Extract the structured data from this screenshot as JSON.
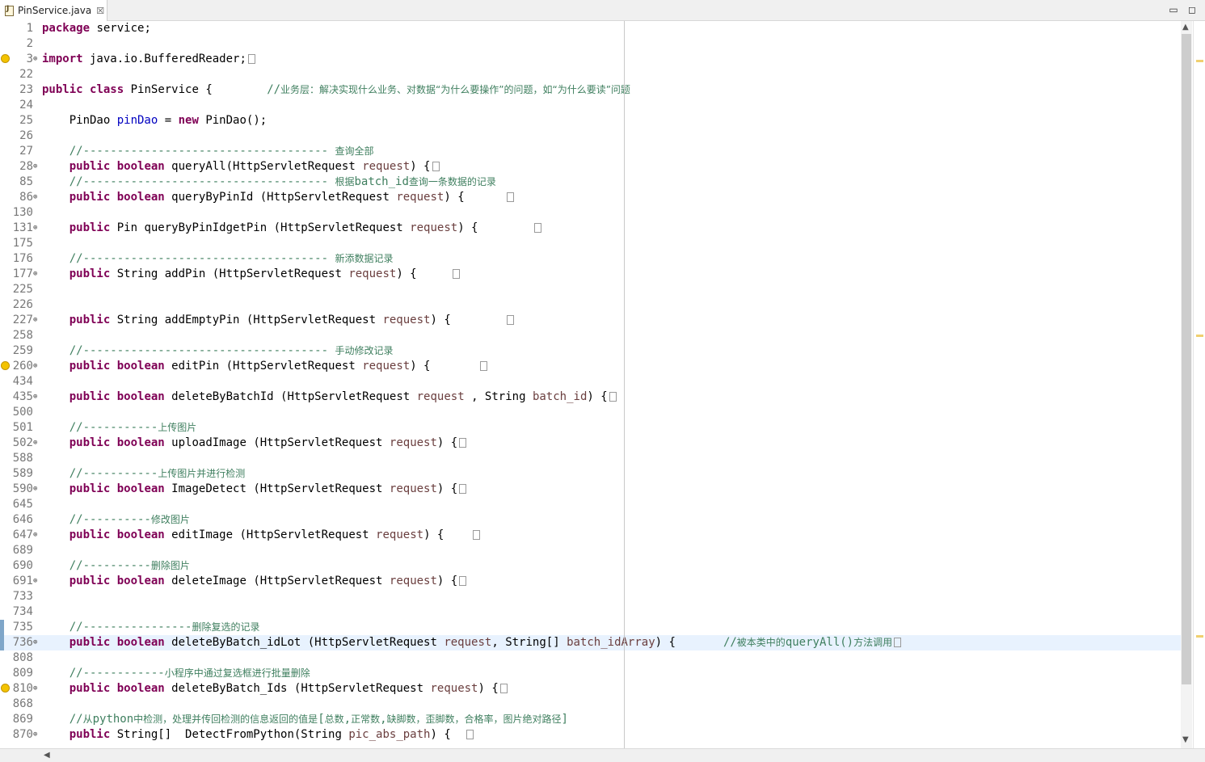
{
  "tab": {
    "title": "PinService.java",
    "close": "☒"
  },
  "window": {
    "minimize": "▭",
    "maximize": "◻"
  },
  "lines": [
    {
      "n": "1",
      "parts": [
        [
          "kw",
          "package"
        ],
        [
          "t",
          " service;"
        ]
      ]
    },
    {
      "n": "2",
      "parts": []
    },
    {
      "n": "3",
      "fold": true,
      "warn": true,
      "parts": [
        [
          "kw",
          "import"
        ],
        [
          "t",
          " java.io.BufferedReader;"
        ],
        [
          "box",
          ""
        ]
      ]
    },
    {
      "n": "22",
      "parts": []
    },
    {
      "n": "23",
      "parts": [
        [
          "kw",
          "public"
        ],
        [
          "t",
          " "
        ],
        [
          "kw",
          "class"
        ],
        [
          "t",
          " PinService {        "
        ],
        [
          "cmt",
          "//"
        ],
        [
          "cmtcn",
          "业务层：解决实现什么业务、对数据“为什么要操作”的问题，如“为什么要读”问题"
        ]
      ]
    },
    {
      "n": "24",
      "parts": []
    },
    {
      "n": "25",
      "parts": [
        [
          "t",
          "    PinDao "
        ],
        [
          "fld",
          "pinDao"
        ],
        [
          "t",
          " = "
        ],
        [
          "kw",
          "new"
        ],
        [
          "t",
          " PinDao();"
        ]
      ]
    },
    {
      "n": "26",
      "parts": []
    },
    {
      "n": "27",
      "parts": [
        [
          "t",
          "    "
        ],
        [
          "cmt",
          "//------------------------------------ "
        ],
        [
          "cmtcn",
          "查询全部"
        ]
      ]
    },
    {
      "n": "28",
      "fold": true,
      "parts": [
        [
          "t",
          "    "
        ],
        [
          "kw",
          "public"
        ],
        [
          "t",
          " "
        ],
        [
          "kw",
          "boolean"
        ],
        [
          "t",
          " queryAll(HttpServletRequest "
        ],
        [
          "prm",
          "request"
        ],
        [
          "t",
          ") {"
        ],
        [
          "box",
          ""
        ]
      ]
    },
    {
      "n": "85",
      "parts": [
        [
          "t",
          "    "
        ],
        [
          "cmt",
          "//------------------------------------ "
        ],
        [
          "cmtcn",
          "根据"
        ],
        [
          "cmt",
          "batch_id"
        ],
        [
          "cmtcn",
          "查询一条数据的记录"
        ]
      ]
    },
    {
      "n": "86",
      "fold": true,
      "parts": [
        [
          "t",
          "    "
        ],
        [
          "kw",
          "public"
        ],
        [
          "t",
          " "
        ],
        [
          "kw",
          "boolean"
        ],
        [
          "t",
          " queryByPinId (HttpServletRequest "
        ],
        [
          "prm",
          "request"
        ],
        [
          "t",
          ") {      "
        ],
        [
          "box",
          ""
        ]
      ]
    },
    {
      "n": "130",
      "parts": []
    },
    {
      "n": "131",
      "fold": true,
      "parts": [
        [
          "t",
          "    "
        ],
        [
          "kw",
          "public"
        ],
        [
          "t",
          " Pin queryByPinIdgetPin (HttpServletRequest "
        ],
        [
          "prm",
          "request"
        ],
        [
          "t",
          ") {        "
        ],
        [
          "box",
          ""
        ]
      ]
    },
    {
      "n": "175",
      "parts": []
    },
    {
      "n": "176",
      "parts": [
        [
          "t",
          "    "
        ],
        [
          "cmt",
          "//------------------------------------ "
        ],
        [
          "cmtcn",
          "新添数据记录"
        ]
      ]
    },
    {
      "n": "177",
      "fold": true,
      "parts": [
        [
          "t",
          "    "
        ],
        [
          "kw",
          "public"
        ],
        [
          "t",
          " String addPin (HttpServletRequest "
        ],
        [
          "prm",
          "request"
        ],
        [
          "t",
          ") {     "
        ],
        [
          "box",
          ""
        ]
      ]
    },
    {
      "n": "225",
      "parts": []
    },
    {
      "n": "226",
      "parts": []
    },
    {
      "n": "227",
      "fold": true,
      "parts": [
        [
          "t",
          "    "
        ],
        [
          "kw",
          "public"
        ],
        [
          "t",
          " String addEmptyPin (HttpServletRequest "
        ],
        [
          "prm",
          "request"
        ],
        [
          "t",
          ") {        "
        ],
        [
          "box",
          ""
        ]
      ]
    },
    {
      "n": "258",
      "parts": []
    },
    {
      "n": "259",
      "parts": [
        [
          "t",
          "    "
        ],
        [
          "cmt",
          "//------------------------------------ "
        ],
        [
          "cmtcn",
          "手动修改记录"
        ]
      ]
    },
    {
      "n": "260",
      "fold": true,
      "warn": true,
      "parts": [
        [
          "t",
          "    "
        ],
        [
          "kw",
          "public"
        ],
        [
          "t",
          " "
        ],
        [
          "kw",
          "boolean"
        ],
        [
          "t",
          " editPin (HttpServletRequest "
        ],
        [
          "prm",
          "request"
        ],
        [
          "t",
          ") {       "
        ],
        [
          "box",
          ""
        ]
      ]
    },
    {
      "n": "434",
      "parts": []
    },
    {
      "n": "435",
      "fold": true,
      "parts": [
        [
          "t",
          "    "
        ],
        [
          "kw",
          "public"
        ],
        [
          "t",
          " "
        ],
        [
          "kw",
          "boolean"
        ],
        [
          "t",
          " deleteByBatchId (HttpServletRequest "
        ],
        [
          "prm",
          "request"
        ],
        [
          "t",
          " , String "
        ],
        [
          "prm",
          "batch_id"
        ],
        [
          "t",
          ") {"
        ],
        [
          "box",
          ""
        ]
      ]
    },
    {
      "n": "500",
      "parts": []
    },
    {
      "n": "501",
      "parts": [
        [
          "t",
          "    "
        ],
        [
          "cmt",
          "//-----------"
        ],
        [
          "cmtcn",
          "上传图片"
        ]
      ]
    },
    {
      "n": "502",
      "fold": true,
      "parts": [
        [
          "t",
          "    "
        ],
        [
          "kw",
          "public"
        ],
        [
          "t",
          " "
        ],
        [
          "kw",
          "boolean"
        ],
        [
          "t",
          " uploadImage (HttpServletRequest "
        ],
        [
          "prm",
          "request"
        ],
        [
          "t",
          ") {"
        ],
        [
          "box",
          ""
        ]
      ]
    },
    {
      "n": "588",
      "parts": []
    },
    {
      "n": "589",
      "parts": [
        [
          "t",
          "    "
        ],
        [
          "cmt",
          "//-----------"
        ],
        [
          "cmtcn",
          "上传图片并进行检测"
        ]
      ]
    },
    {
      "n": "590",
      "fold": true,
      "parts": [
        [
          "t",
          "    "
        ],
        [
          "kw",
          "public"
        ],
        [
          "t",
          " "
        ],
        [
          "kw",
          "boolean"
        ],
        [
          "t",
          " ImageDetect (HttpServletRequest "
        ],
        [
          "prm",
          "request"
        ],
        [
          "t",
          ") {"
        ],
        [
          "box",
          ""
        ]
      ]
    },
    {
      "n": "645",
      "parts": []
    },
    {
      "n": "646",
      "parts": [
        [
          "t",
          "    "
        ],
        [
          "cmt",
          "//----------"
        ],
        [
          "cmtcn",
          "修改图片"
        ]
      ]
    },
    {
      "n": "647",
      "fold": true,
      "parts": [
        [
          "t",
          "    "
        ],
        [
          "kw",
          "public"
        ],
        [
          "t",
          " "
        ],
        [
          "kw",
          "boolean"
        ],
        [
          "t",
          " editImage (HttpServletRequest "
        ],
        [
          "prm",
          "request"
        ],
        [
          "t",
          ") {    "
        ],
        [
          "box",
          ""
        ]
      ]
    },
    {
      "n": "689",
      "parts": []
    },
    {
      "n": "690",
      "parts": [
        [
          "t",
          "    "
        ],
        [
          "cmt",
          "//----------"
        ],
        [
          "cmtcn",
          "删除图片"
        ]
      ]
    },
    {
      "n": "691",
      "fold": true,
      "parts": [
        [
          "t",
          "    "
        ],
        [
          "kw",
          "public"
        ],
        [
          "t",
          " "
        ],
        [
          "kw",
          "boolean"
        ],
        [
          "t",
          " deleteImage (HttpServletRequest "
        ],
        [
          "prm",
          "request"
        ],
        [
          "t",
          ") {"
        ],
        [
          "box",
          ""
        ]
      ]
    },
    {
      "n": "733",
      "parts": []
    },
    {
      "n": "734",
      "parts": []
    },
    {
      "n": "735",
      "change": true,
      "parts": [
        [
          "t",
          "    "
        ],
        [
          "cmt",
          "//----------------"
        ],
        [
          "cmtcn",
          "删除复选的记录"
        ]
      ]
    },
    {
      "n": "736",
      "fold": true,
      "change": true,
      "current": true,
      "parts": [
        [
          "t",
          "    "
        ],
        [
          "kw",
          "public"
        ],
        [
          "t",
          " "
        ],
        [
          "kw",
          "boolean"
        ],
        [
          "t",
          " deleteByBatch_idLot (HttpServletRequest "
        ],
        [
          "prm",
          "request"
        ],
        [
          "t",
          ", String[] "
        ],
        [
          "prm",
          "batch_idArray"
        ],
        [
          "t",
          ") {       "
        ],
        [
          "cmt",
          "//"
        ],
        [
          "cmtcn",
          "被本类中的"
        ],
        [
          "cmt",
          "queryAll()"
        ],
        [
          "cmtcn",
          "方法调用"
        ],
        [
          "box",
          ""
        ]
      ]
    },
    {
      "n": "808",
      "parts": []
    },
    {
      "n": "809",
      "parts": [
        [
          "t",
          "    "
        ],
        [
          "cmt",
          "//------------"
        ],
        [
          "cmtcn",
          "小程序中通过复选框进行批量删除"
        ]
      ]
    },
    {
      "n": "810",
      "fold": true,
      "warn": true,
      "parts": [
        [
          "t",
          "    "
        ],
        [
          "kw",
          "public"
        ],
        [
          "t",
          " "
        ],
        [
          "kw",
          "boolean"
        ],
        [
          "t",
          " deleteByBatch_Ids (HttpServletRequest "
        ],
        [
          "prm",
          "request"
        ],
        [
          "t",
          ") {"
        ],
        [
          "box",
          ""
        ]
      ]
    },
    {
      "n": "868",
      "parts": []
    },
    {
      "n": "869",
      "parts": [
        [
          "t",
          "    "
        ],
        [
          "cmt",
          "//"
        ],
        [
          "cmtcn",
          "从"
        ],
        [
          "cmt",
          "python"
        ],
        [
          "cmtcn",
          "中检测，处理并传回检测的信息返回的值是"
        ],
        [
          "cmt",
          "["
        ],
        [
          "cmtcn",
          "总数"
        ],
        [
          "cmt",
          ","
        ],
        [
          "cmtcn",
          "正常数"
        ],
        [
          "cmt",
          ","
        ],
        [
          "cmtcn",
          "缺脚数，歪脚数，合格率，图片绝对路径"
        ],
        [
          "cmt",
          "]"
        ]
      ]
    },
    {
      "n": "870",
      "fold": true,
      "parts": [
        [
          "t",
          "    "
        ],
        [
          "kw",
          "public"
        ],
        [
          "t",
          " String[]  DetectFromPython(String "
        ],
        [
          "prm",
          "pic_abs_path"
        ],
        [
          "t",
          ") {  "
        ],
        [
          "box",
          ""
        ]
      ]
    }
  ]
}
